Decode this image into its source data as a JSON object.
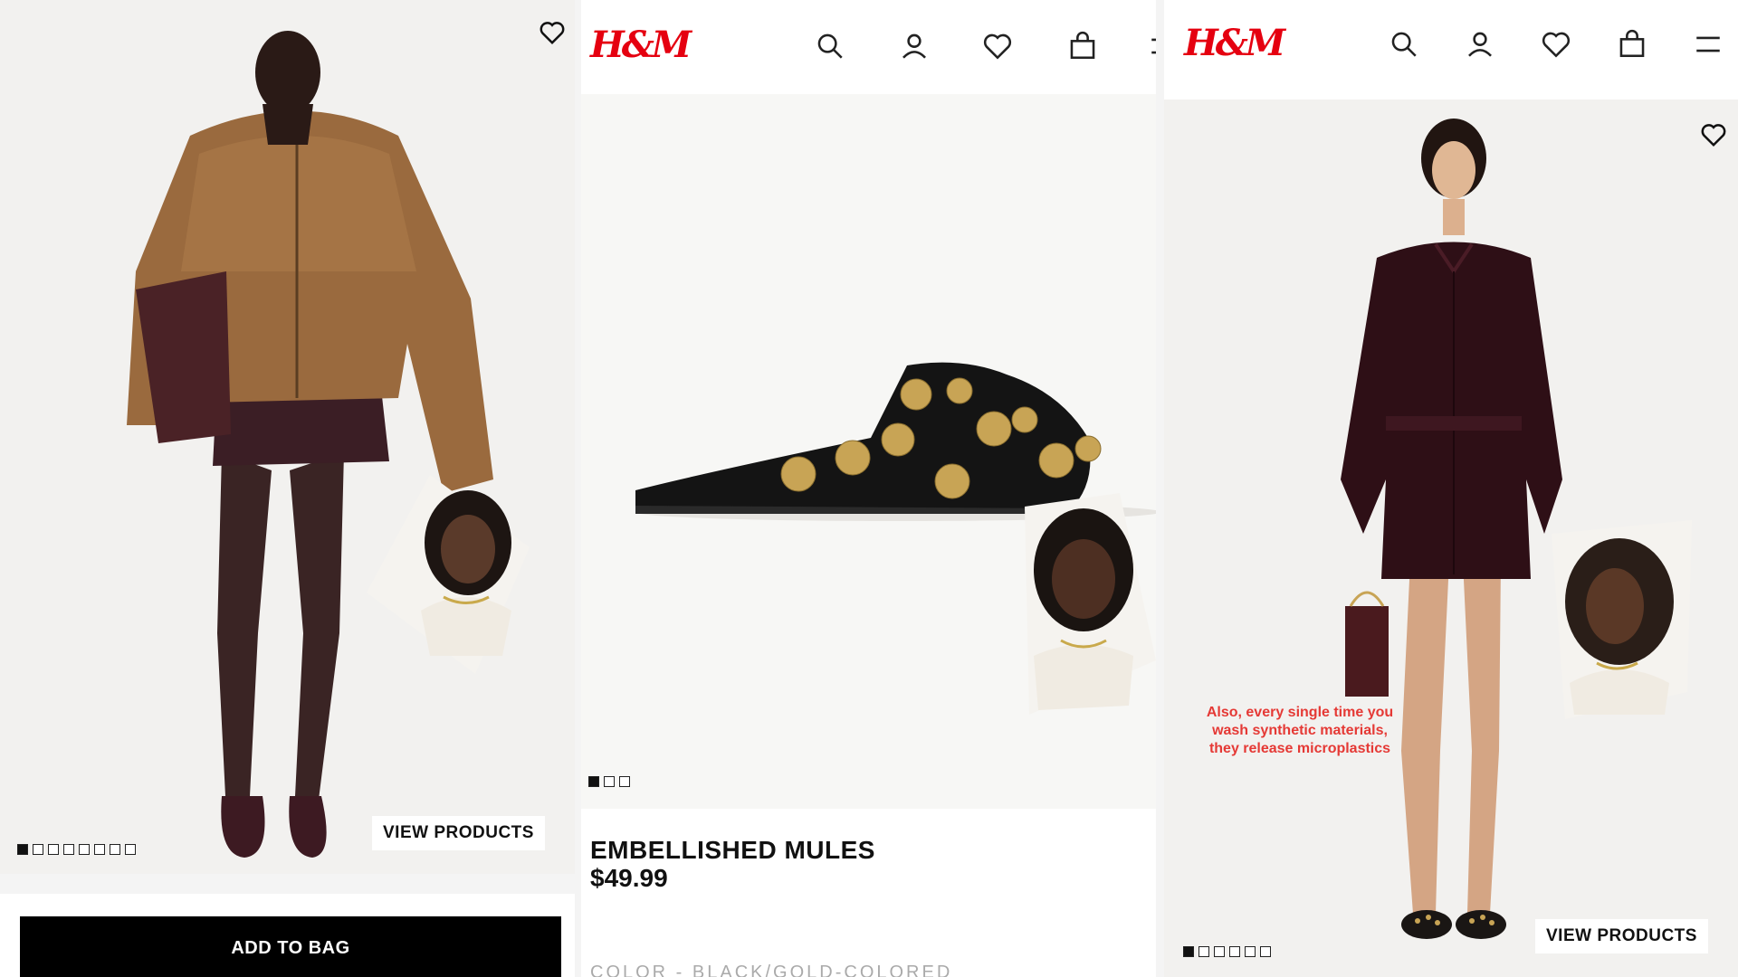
{
  "panels": [
    {
      "id": "fur-jacket-look",
      "dots_total": 8,
      "dots_active": 1,
      "view_products_label": "VIEW PRODUCTS",
      "add_to_bag_label": "ADD TO BAG",
      "icons": [
        "heart-icon"
      ]
    },
    {
      "id": "mules-product",
      "header": {
        "logo": "H&M",
        "icons": [
          "search-icon",
          "account-icon",
          "heart-icon",
          "bag-icon",
          "menu-icon"
        ]
      },
      "dots_total": 3,
      "dots_active": 1,
      "product_name": "EMBELLISHED MULES",
      "product_price": "$49.99",
      "product_meta": "COLOR - BLACK/GOLD-COLORED"
    },
    {
      "id": "leather-dress-look",
      "header": {
        "logo": "H&M",
        "icons": [
          "search-icon",
          "account-icon",
          "heart-icon",
          "bag-icon",
          "menu-icon"
        ]
      },
      "caption": "Also, every single time you wash synthetic materials, they release microplastics",
      "dots_total": 6,
      "dots_active": 1,
      "view_products_label": "VIEW PRODUCTS",
      "icons": [
        "heart-icon"
      ]
    }
  ],
  "colors": {
    "brand": "#e50010",
    "caption": "#e53935",
    "button_bg": "#000000"
  }
}
